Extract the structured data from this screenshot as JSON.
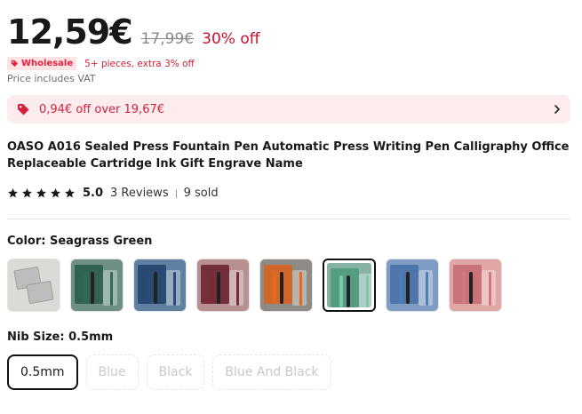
{
  "price": {
    "current": "12,59€",
    "original": "17,99€",
    "discount": "30% off"
  },
  "wholesale": {
    "badge": "Wholesale",
    "note": "5+ pieces, extra 3% off"
  },
  "vat_note": "Price includes VAT",
  "coupon": {
    "text": "0,94€ off over 19,67€",
    "icon": "tag-icon"
  },
  "product": {
    "title": "OASO A016 Sealed Press Fountain Pen Automatic Press Writing Pen Calligraphy Office Replaceable Cartridge Ink Gift Engrave Name"
  },
  "rating": {
    "value": "5.0",
    "reviews": "3 Reviews",
    "sold": "9 sold",
    "stars": 5
  },
  "color": {
    "label": "Color: Seagrass Green",
    "selected_index": 5,
    "options": [
      {
        "bg": "#dcdad6",
        "pen": "#8e8e8e",
        "pack": "#bdbdbd"
      },
      {
        "bg": "#6e8f86",
        "pen": "#2e6a55",
        "pack": "#2b5d4c"
      },
      {
        "bg": "#5f80a0",
        "pen": "#2b4a7a",
        "pack": "#24446e"
      },
      {
        "bg": "#b89092",
        "pen": "#7a2c36",
        "pack": "#6d2631"
      },
      {
        "bg": "#8e8a86",
        "pen": "#e46a1e",
        "pack": "#d8641f"
      },
      {
        "bg": "#86b3a3",
        "pen": "#7dc7a8",
        "pack": "#4f9a7d"
      },
      {
        "bg": "#7f9dc4",
        "pen": "#4f7db8",
        "pack": "#4a72a8"
      },
      {
        "bg": "#e0a5a5",
        "pen": "#d0787d",
        "pack": "#c86d74"
      }
    ]
  },
  "nib": {
    "label": "Nib Size: 0.5mm",
    "options": [
      "0.5mm",
      "Blue",
      "Black",
      "Blue And Black"
    ],
    "selected_index": 0
  },
  "colors": {
    "accent_red": "#d4213a",
    "coupon_bg": "#fdecee",
    "text": "#191919"
  }
}
